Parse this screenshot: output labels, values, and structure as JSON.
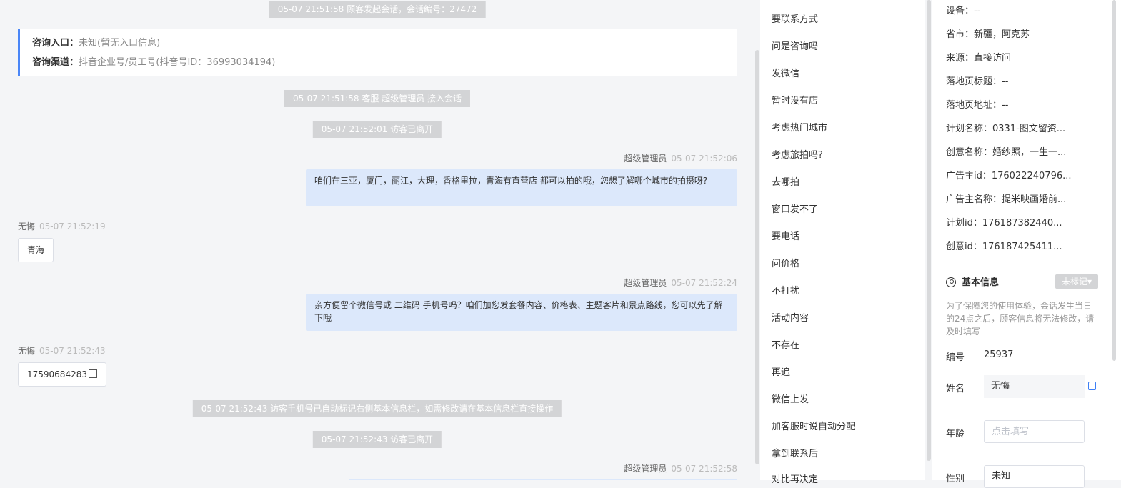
{
  "chat": {
    "sys1": "05-07 21:51:58 顾客发起会话，会话编号：27472",
    "entry_label": "咨询入口：",
    "entry_value": "未知(暂无入口信息)",
    "channel_label": "咨询渠道：",
    "channel_value": "抖音企业号/员工号(抖音号ID：36993034194)",
    "sys2": "05-07 21:51:58 客服 超级管理员 接入会话",
    "sys3": "05-07 21:52:01 访客已离开",
    "m1_sender": "超级管理员",
    "m1_time": "05-07 21:52:06",
    "m1_text": "咱们在三亚，厦门，丽江，大理，香格里拉，青海有直营店 都可以拍的哦，您想了解哪个城市的拍摄呀?",
    "v1_sender": "无悔",
    "v1_time": "05-07 21:52:19",
    "v1_text": "青海",
    "m2_sender": "超级管理员",
    "m2_time": "05-07 21:52:24",
    "m2_text": "亲方便留个微信号或 二维码 手机号吗？咱们加您发套餐内容、价格表、主题客片和景点路线，您可以先了解下哦",
    "v2_sender": "无悔",
    "v2_time": "05-07 21:52:43",
    "v2_text": "17590684283",
    "sys4": "05-07 21:52:43 访客手机号已自动标记右侧基本信息栏，如需修改请在基本信息栏直接操作",
    "sys5": "05-07 21:52:43 访客已离开",
    "m3_sender": "超级管理员",
    "m3_time": "05-07 21:52:58"
  },
  "quick_replies": [
    "要联系方式",
    "问是咨询吗",
    "发微信",
    "暂时没有店",
    "考虑热门城市",
    "考虑旅拍吗?",
    "去哪拍",
    "窗口发不了",
    "要电话",
    "问价格",
    "不打扰",
    "活动内容",
    "不存在",
    "再追",
    "微信上发",
    "加客服时说自动分配",
    "拿到联系后",
    "对比再决定"
  ],
  "info": {
    "device": "设备：--",
    "province": "省市：新疆，阿克苏",
    "source": "来源：直接访问",
    "landing_title": "落地页标题：--",
    "landing_url": "落地页地址：--",
    "plan_name": "计划名称：0331-图文留资...",
    "creative_name": "创意名称：婚纱照，一生一...",
    "advertiser_id": "广告主id：176022240796...",
    "advertiser_name": "广告主名称：提米映画婚前...",
    "plan_id": "计划id：176187382440...",
    "creative_id": "创意id：176187425411..."
  },
  "basic": {
    "title": "基本信息",
    "tag": "未标记",
    "notice": "为了保障您的使用体验，会话发生当日的24点之后，顾客信息将无法修改，请及时填写",
    "id_label": "编号",
    "id_value": "25937",
    "name_label": "姓名",
    "name_value": "无悔",
    "age_label": "年龄",
    "age_placeholder": "点击填写",
    "gender_label": "性别",
    "gender_value": "未知"
  }
}
